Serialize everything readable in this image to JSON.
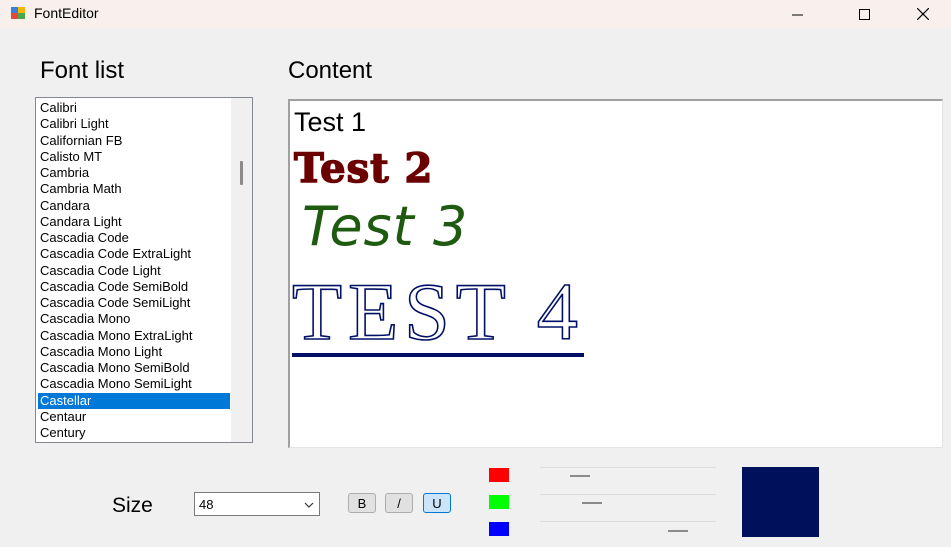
{
  "window": {
    "title": "FontEditor",
    "minimize_label": "—",
    "maximize_label": "☐",
    "close_label": "✕"
  },
  "font_list": {
    "heading": "Font list",
    "items": [
      "Calibri",
      "Calibri Light",
      "Californian FB",
      "Calisto MT",
      "Cambria",
      "Cambria Math",
      "Candara",
      "Candara Light",
      "Cascadia Code",
      "Cascadia Code ExtraLight",
      "Cascadia Code Light",
      "Cascadia Code SemiBold",
      "Cascadia Code SemiLight",
      "Cascadia Mono",
      "Cascadia Mono ExtraLight",
      "Cascadia Mono Light",
      "Cascadia Mono SemiBold",
      "Cascadia Mono SemiLight",
      "Castellar",
      "Centaur",
      "Century"
    ],
    "selected": "Castellar"
  },
  "content": {
    "heading": "Content",
    "lines": [
      "Test 1",
      "Test 2",
      "Test 3",
      "TEST 4"
    ]
  },
  "size": {
    "label": "Size",
    "value": "48"
  },
  "style_buttons": {
    "bold": "B",
    "italic": "/",
    "underline": "U",
    "active": "underline"
  },
  "colors": {
    "red_swatch": "#ff0000",
    "green_swatch": "#00ff00",
    "blue_swatch": "#0000ff",
    "preview": "#00105a",
    "red_level": 0.19,
    "green_level": 0.27,
    "blue_level": 0.82
  }
}
